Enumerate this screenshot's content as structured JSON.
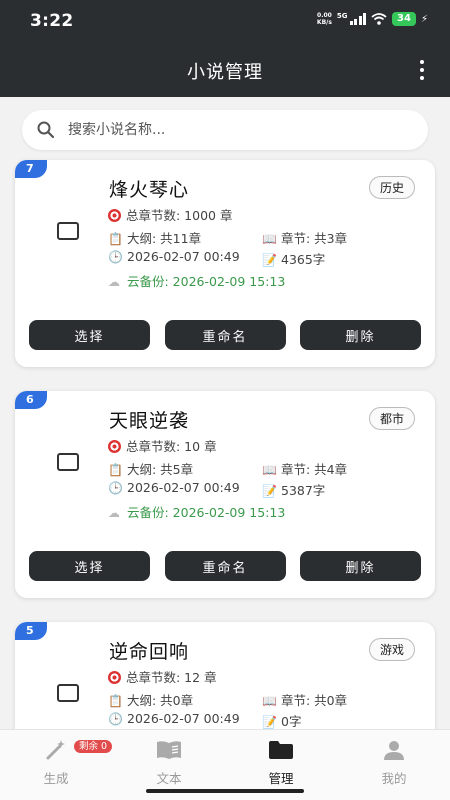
{
  "status_bar": {
    "time": "3:22",
    "net_speed_value": "0.00",
    "net_speed_unit": "KB/s",
    "signal_label": "5G",
    "battery": "34"
  },
  "header": {
    "title": "小说管理"
  },
  "search": {
    "placeholder": "搜索小说名称..."
  },
  "novels": [
    {
      "index": "7",
      "title": "烽火琴心",
      "genre": "历史",
      "total_chapters": "总章节数: 1000 章",
      "outline": "大纲: 共11章",
      "chapters": "章节: 共3章",
      "created": "2026-02-07 00:49",
      "words": "4365字",
      "backup": "云备份: 2026-02-09 15:13"
    },
    {
      "index": "6",
      "title": "天眼逆袭",
      "genre": "都市",
      "total_chapters": "总章节数: 10 章",
      "outline": "大纲: 共5章",
      "chapters": "章节: 共4章",
      "created": "2026-02-07 00:49",
      "words": "5387字",
      "backup": "云备份: 2026-02-09 15:13"
    },
    {
      "index": "5",
      "title": "逆命回响",
      "genre": "游戏",
      "total_chapters": "总章节数: 12 章",
      "outline": "大纲: 共0章",
      "chapters": "章节: 共0章",
      "created": "2026-02-07 00:49",
      "words": "0字",
      "backup": ""
    }
  ],
  "actions": {
    "select": "选择",
    "rename": "重命名",
    "delete": "删除"
  },
  "bottom_nav": {
    "generate": "生成",
    "generate_badge": "剩余 0",
    "text": "文本",
    "manage": "管理",
    "mine": "我的"
  },
  "colors": {
    "header": "#2b2e30",
    "accent": "#2f6fe0",
    "backup": "#3a9a4a",
    "badge": "#e24b4b"
  }
}
